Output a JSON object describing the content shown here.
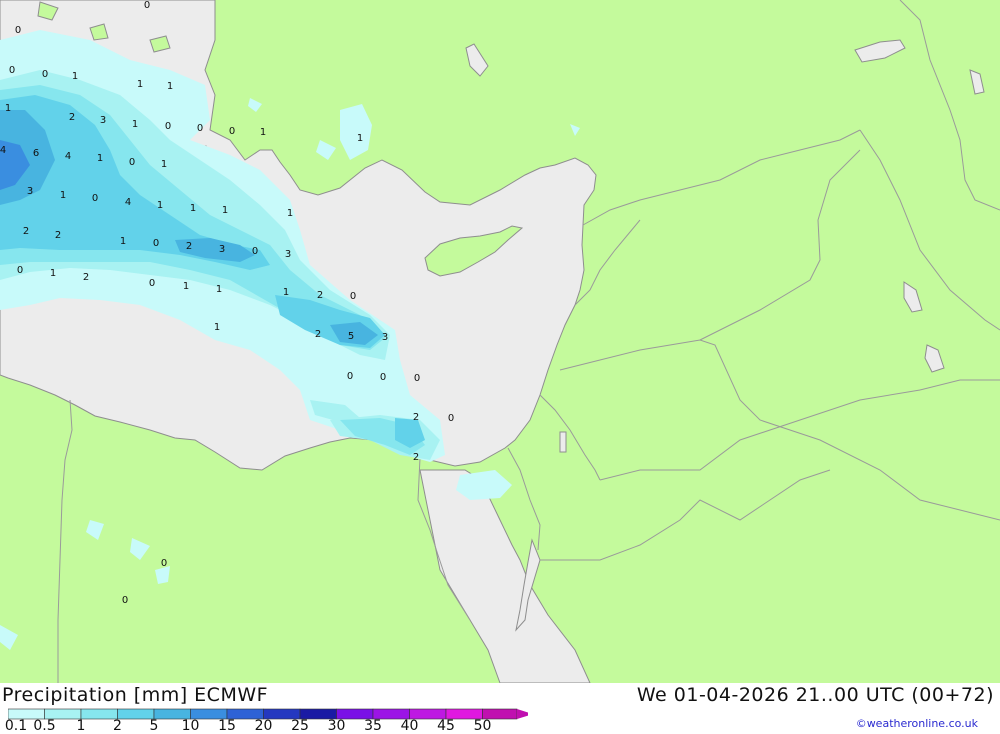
{
  "legend": {
    "title": "Precipitation [mm] ECMWF",
    "datetime": "We 01-04-2026 21..00 UTC (00+72)",
    "credit": "©weatheronline.co.uk",
    "scale_values": [
      "0.1",
      "0.5",
      "1",
      "2",
      "5",
      "10",
      "15",
      "20",
      "25",
      "30",
      "35",
      "40",
      "45",
      "50"
    ],
    "scale_colors": [
      "#c8fafa",
      "#a8f2f2",
      "#86e6ee",
      "#62d2ea",
      "#48b4e0",
      "#3a8ee0",
      "#2e62d6",
      "#2438c0",
      "#1a1aa4",
      "#7a10e6",
      "#9c14e6",
      "#be18e2",
      "#e018e0",
      "#c010b0"
    ]
  },
  "map": {
    "colors": {
      "land": "#c4fa9c",
      "sea": "#ececec",
      "border": "#9a9a9a",
      "coast": "#8e8e8e"
    },
    "precip_values": [
      "0",
      "0",
      "0",
      "1",
      "0",
      "1",
      "1",
      "1",
      "2",
      "3",
      "1",
      "0",
      "0",
      "0",
      "1",
      "1",
      "4",
      "6",
      "4",
      "1",
      "0",
      "1",
      "3",
      "1",
      "0",
      "4",
      "1",
      "1",
      "1",
      "1",
      "2",
      "2",
      "1",
      "0",
      "2",
      "3",
      "0",
      "3",
      "0",
      "1",
      "2",
      "0",
      "1",
      "1",
      "1",
      "2",
      "0",
      "1",
      "2",
      "5",
      "3",
      "0",
      "0",
      "0",
      "2",
      "0",
      "2",
      "0",
      "0"
    ]
  }
}
